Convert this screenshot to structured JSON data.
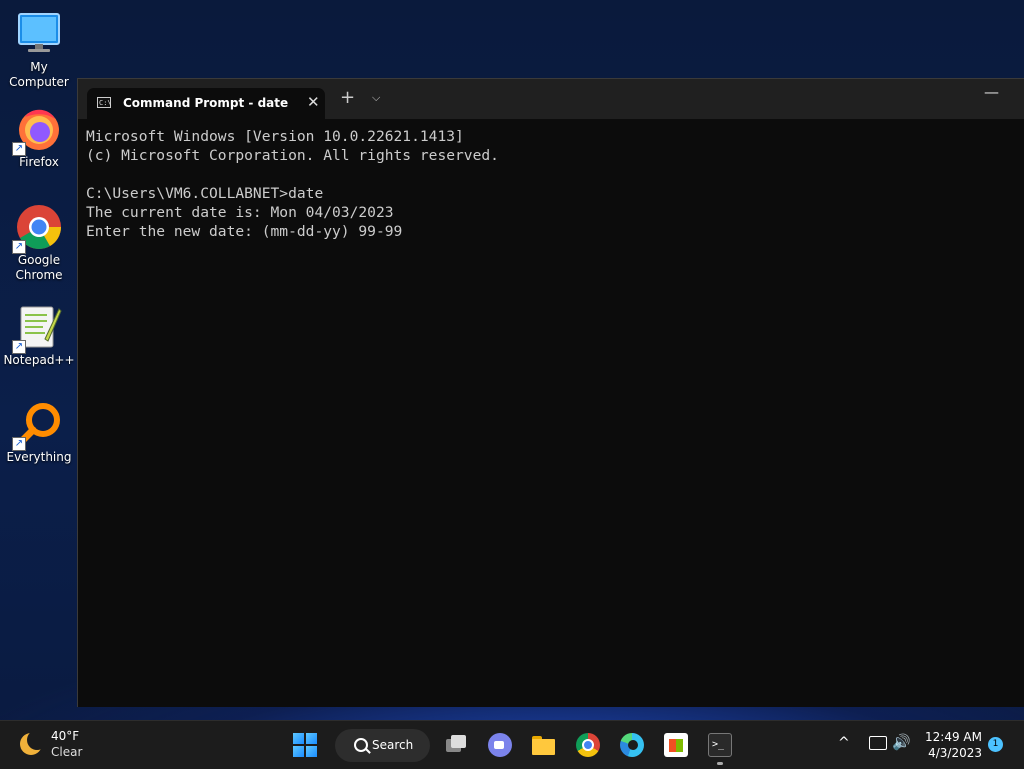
{
  "desktop": {
    "icons": [
      {
        "label": "My Computer",
        "icon": "monitor-icon"
      },
      {
        "label": "Firefox",
        "icon": "firefox-icon"
      },
      {
        "label": "Google Chrome",
        "icon": "chrome-icon"
      },
      {
        "label": "Notepad++",
        "icon": "notepadpp-icon"
      },
      {
        "label": "Everything",
        "icon": "everything-icon"
      }
    ]
  },
  "terminal": {
    "tab_title": "Command Prompt - date",
    "tab_icon_text": "C:\\",
    "close_glyph": "✕",
    "new_tab_glyph": "+",
    "dropdown_glyph": "⌵",
    "minimize_glyph": "—",
    "lines": [
      "Microsoft Windows [Version 10.0.22621.1413]",
      "(c) Microsoft Corporation. All rights reserved.",
      "",
      "C:\\Users\\VM6.COLLABNET>date",
      "The current date is: Mon 04/03/2023",
      "Enter the new date: (mm-dd-yy) 99-99"
    ]
  },
  "taskbar": {
    "weather_temp": "40°F",
    "weather_condition": "Clear",
    "search_label": "Search",
    "apps": [
      "start-button",
      "search",
      "task-view",
      "teams",
      "file-explorer",
      "chrome",
      "edge",
      "microsoft-store",
      "terminal"
    ],
    "clock_time": "12:49 AM",
    "clock_date": "4/3/2023",
    "notification_count": "1",
    "tray_chevron": "^",
    "terminal_glyph": ">_",
    "volume_glyph": "🔊"
  },
  "colors": {
    "console_bg": "#0c0c0c",
    "console_fg": "#cccccc",
    "titlebar_bg": "#202020",
    "taskbar_bg": "#1c1c1c",
    "accent": "#4cc2ff"
  }
}
